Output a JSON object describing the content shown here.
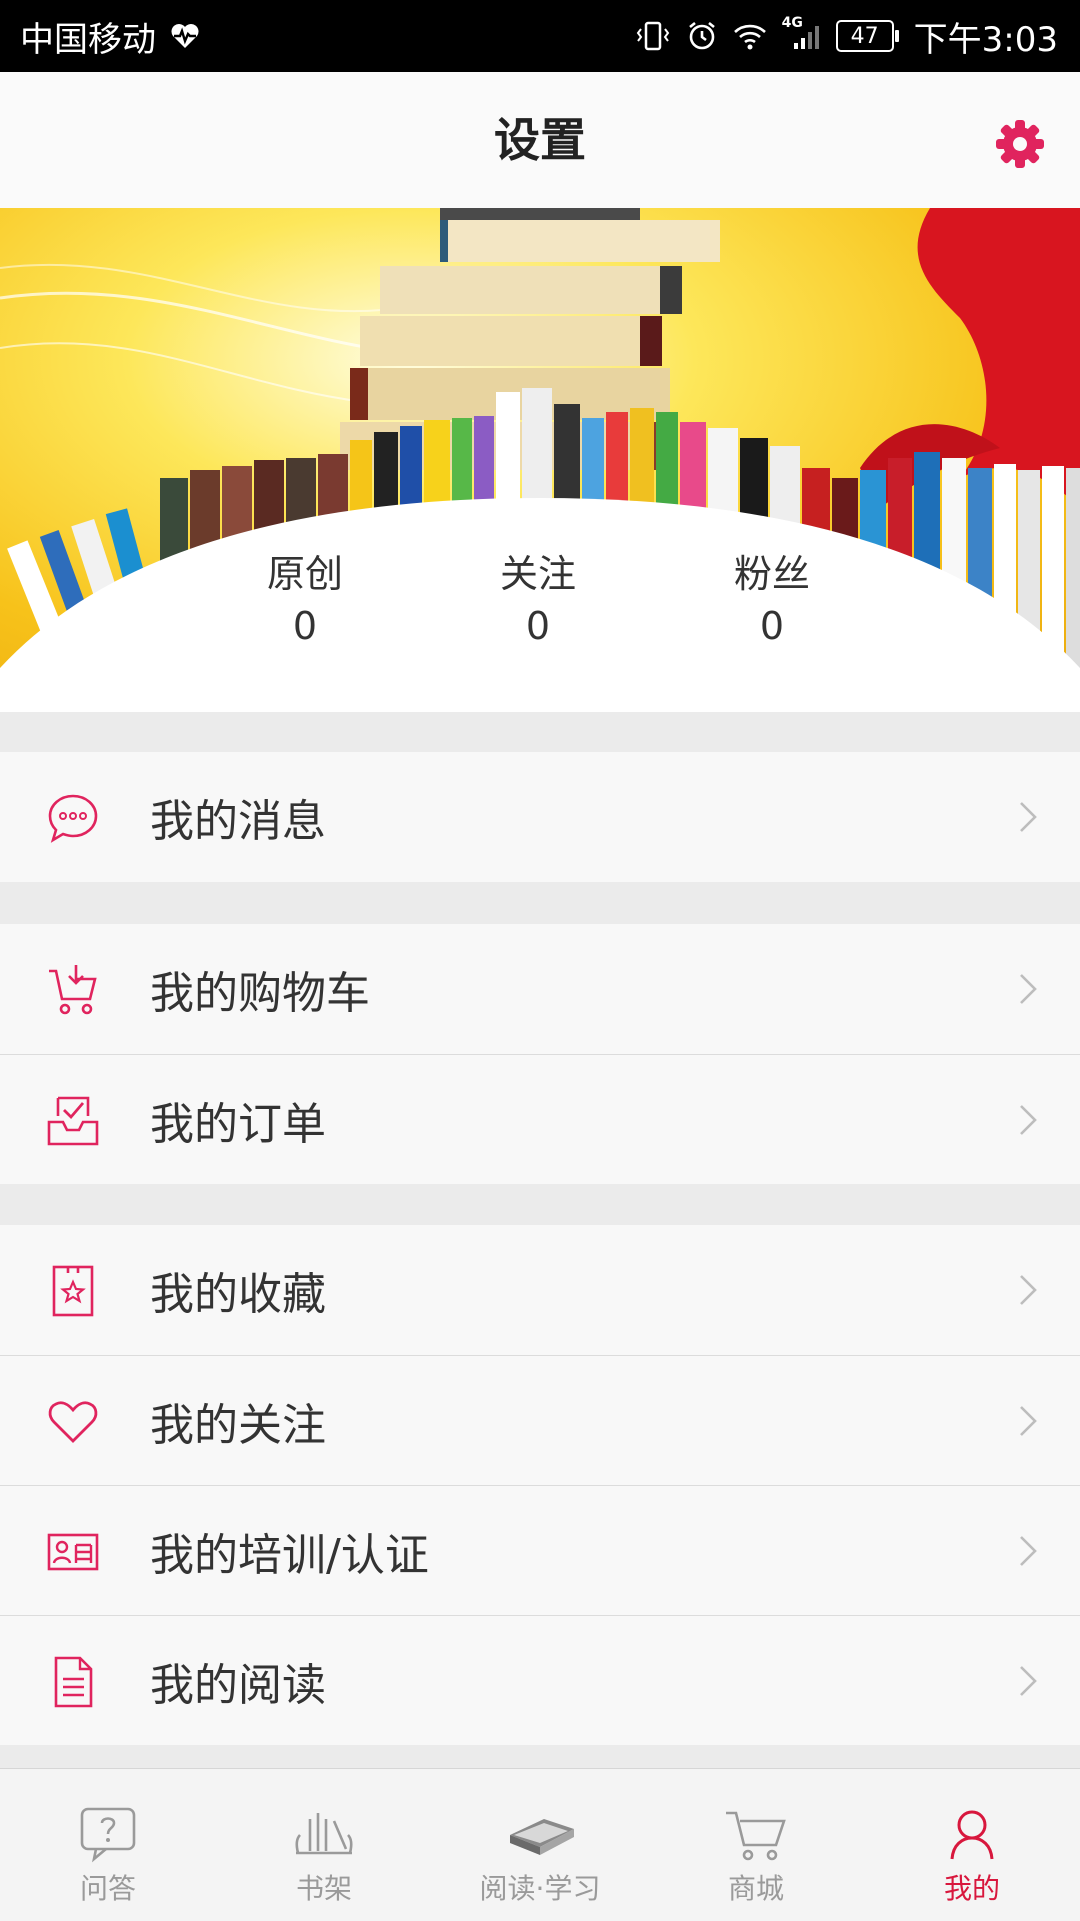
{
  "status_bar": {
    "carrier": "中国移动",
    "network": "4G",
    "battery": "47",
    "time": "下午3:03"
  },
  "header": {
    "title": "设置",
    "settings_icon": "gear-icon"
  },
  "colors": {
    "accent": "#e0245e",
    "nav_active": "#d8173d",
    "nav_inactive": "#9a9a9a"
  },
  "stats": [
    {
      "label": "原创",
      "value": "0"
    },
    {
      "label": "关注",
      "value": "0"
    },
    {
      "label": "粉丝",
      "value": "0"
    }
  ],
  "menu_groups": [
    [
      {
        "label": "我的消息",
        "icon": "chat-bubble-icon"
      }
    ],
    [
      {
        "label": "我的购物车",
        "icon": "shopping-cart-icon"
      },
      {
        "label": "我的订单",
        "icon": "order-inbox-icon"
      }
    ],
    [
      {
        "label": "我的收藏",
        "icon": "bookmark-star-icon"
      },
      {
        "label": "我的关注",
        "icon": "heart-icon"
      },
      {
        "label": "我的培训/认证",
        "icon": "certificate-icon"
      },
      {
        "label": "我的阅读",
        "icon": "document-icon"
      }
    ]
  ],
  "bottom_nav": [
    {
      "label": "问答",
      "icon": "question-bubble-icon",
      "active": false
    },
    {
      "label": "书架",
      "icon": "bookshelf-icon",
      "active": false
    },
    {
      "label": "阅读·学习",
      "icon": "book-icon",
      "active": false
    },
    {
      "label": "商城",
      "icon": "cart-icon",
      "active": false
    },
    {
      "label": "我的",
      "icon": "user-icon",
      "active": true
    }
  ]
}
